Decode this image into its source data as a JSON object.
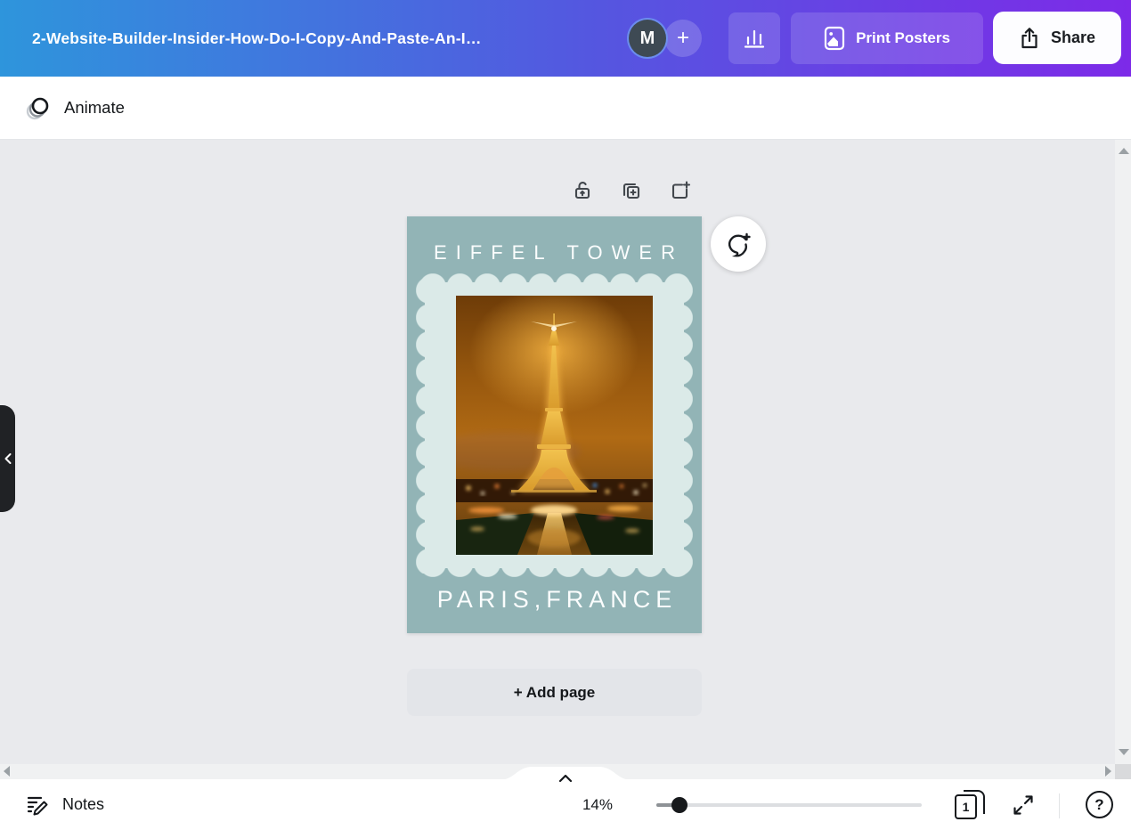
{
  "header": {
    "document_title": "2-Website-Builder-Insider-How-Do-I-Copy-And-Paste-An-I…",
    "avatar_initial": "M",
    "plus_glyph": "+",
    "print_posters_label": "Print Posters",
    "share_label": "Share"
  },
  "toolbar": {
    "animate_label": "Animate"
  },
  "poster": {
    "title": "EIFFEL TOWER",
    "subtitle": "PARIS,FRANCE"
  },
  "canvas": {
    "add_page_label": "+ Add page"
  },
  "statusbar": {
    "notes_label": "Notes",
    "zoom_level": "14%",
    "page_number": "1",
    "help_glyph": "?"
  },
  "colors": {
    "topbar_start": "#2e95dc",
    "topbar_mid": "#5457e0",
    "topbar_end": "#7d2ae8",
    "poster_bg": "#92b4b6",
    "frame_color": "#dbeae8"
  }
}
